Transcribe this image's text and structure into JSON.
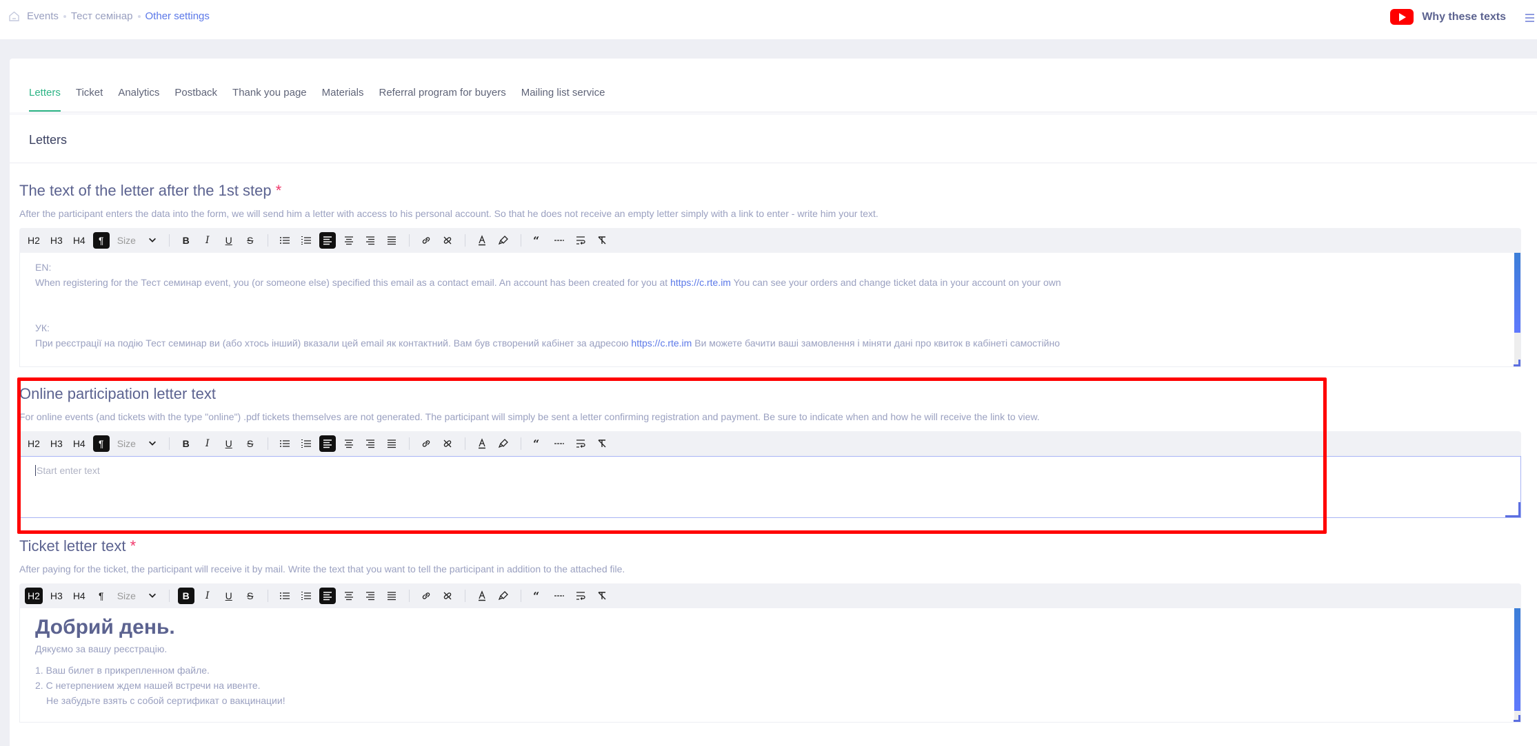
{
  "header": {
    "breadcrumb": [
      {
        "label": "Events",
        "icon": "home-icon"
      },
      {
        "label": "Тест семінар"
      },
      {
        "label": "Other settings",
        "current": true
      }
    ],
    "why_label": "Why these texts",
    "why_icon": "youtube-icon",
    "menu_icon": "hamburger-icon"
  },
  "tabs": [
    {
      "label": "Letters",
      "active": true
    },
    {
      "label": "Ticket"
    },
    {
      "label": "Analytics"
    },
    {
      "label": "Postback"
    },
    {
      "label": "Thank you page"
    },
    {
      "label": "Materials"
    },
    {
      "label": "Referral program for buyers"
    },
    {
      "label": "Mailing list service"
    }
  ],
  "page_heading": "Letters",
  "toolbar": {
    "h2": "H2",
    "h3": "H3",
    "h4": "H4",
    "paragraph": "¶",
    "size_label": "Size",
    "bold": "B",
    "italic": "I",
    "underline": "U",
    "strike": "S"
  },
  "sections": [
    {
      "title": "The text of the letter after the 1st step",
      "required": "*",
      "description": "After the participant enters the data into the form, we will send him a letter with access to his personal account. So that he does not receive an empty letter simply with a link to enter - write him your text.",
      "active_format": "paragraph",
      "content": {
        "en_label": "EN:",
        "en_text_before": "When registering for the Тест семинар event, you (or someone else) specified this email as a contact email. An account has been created for you at ",
        "en_link": "https://c.rte.im",
        "en_text_after": " You can see your orders and change ticket data in your account on your own",
        "uk_label": "УК:",
        "uk_text_before": "При реєстрації на подію Тест семинар ви (або хтось інший) вказали цей email як контактний. Вам був створений кабінет за адресою ",
        "uk_link": "https://c.rte.im",
        "uk_text_after": " Ви можете бачити ваші замовлення і міняти дані про квиток в кабінеті самостійно"
      },
      "scroll_fraction": 0.7
    },
    {
      "title": "Online participation letter text",
      "description": "For online events (and tickets with the type \"online\") .pdf tickets themselves are not generated. The participant will simply be sent a letter confirming registration and payment. Be sure to indicate when and how he will receive the link to view.",
      "active_format": "paragraph",
      "placeholder": "Start enter text",
      "value": ""
    },
    {
      "title": "Ticket letter text",
      "required": "*",
      "description": "After paying for the ticket, the participant will receive it by mail. Write the text that you want to tell the participant in addition to the attached file.",
      "active_format": "h2",
      "content": {
        "heading": "Добрий день.",
        "line1": "Дякуємо за вашу реєстрацію.",
        "item1": "1. Ваш билет в прикрепленном файле.",
        "item2": "2. С нетерпением ждем нашей встречи на ивенте.",
        "item2_cont": "Не забудьте взять с собой сертификат о вакцинации!"
      },
      "scroll_fraction": 0.9
    }
  ],
  "colors": {
    "accent_tab": "#2cb485",
    "link": "#5b78e8",
    "required": "#f0386b",
    "highlight": "#ff0000",
    "youtube": "#ff0000"
  }
}
